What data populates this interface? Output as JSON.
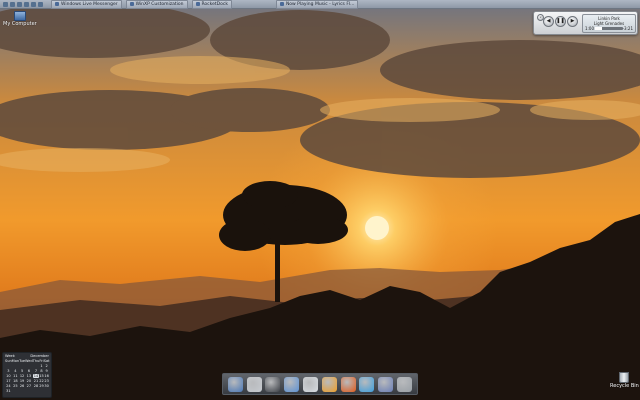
{
  "taskbar": {
    "tasks": [
      {
        "label": "Windows Live Messenger",
        "icon": "messenger-icon"
      },
      {
        "label": "WinXP Customization",
        "icon": "folder-icon"
      },
      {
        "label": "RocketDock",
        "icon": "dock-icon"
      },
      {
        "label": "Now Playing Music - Lyrics Fl...",
        "icon": "media-player-icon"
      }
    ]
  },
  "desktop_icons": {
    "my_computer": "My Computer",
    "recycle_bin": "Recycle Bin"
  },
  "player": {
    "artist": "Linkin Park",
    "track": "Light Grenades",
    "elapsed": "1:00",
    "remaining": "-3:21",
    "progress": 0.25
  },
  "calendar": {
    "week_label": "Week",
    "month": "December",
    "weekdays": [
      "Sun",
      "Mon",
      "Tue",
      "Wed",
      "Thu",
      "Fri",
      "Sat"
    ],
    "days": [
      "",
      "",
      "",
      "",
      "",
      "1",
      "2",
      "3",
      "4",
      "5",
      "6",
      "7",
      "8",
      "9",
      "10",
      "11",
      "12",
      "13",
      "14",
      "15",
      "16",
      "17",
      "18",
      "19",
      "20",
      "21",
      "22",
      "23",
      "24",
      "25",
      "26",
      "27",
      "28",
      "29",
      "30",
      "31",
      ""
    ],
    "today": "14"
  },
  "dock": {
    "items": [
      {
        "name": "my-computer-dock-icon",
        "color": "#4a78b8"
      },
      {
        "name": "apple-dock-icon",
        "color": "#c8ccd2"
      },
      {
        "name": "paw-dock-icon",
        "color": "#3b3f46"
      },
      {
        "name": "wing-dock-icon",
        "color": "#5e93d6"
      },
      {
        "name": "chrome-ball-dock-icon",
        "color": "#d9dde2"
      },
      {
        "name": "safari-dock-icon",
        "color": "#f0a02a"
      },
      {
        "name": "firefox-dock-icon",
        "color": "#e25d1e"
      },
      {
        "name": "vlc-dock-icon",
        "color": "#3da0e0"
      },
      {
        "name": "tools-dock-icon",
        "color": "#6a7fb8"
      },
      {
        "name": "trash-dock-icon",
        "color": "#9aa1a8"
      }
    ]
  },
  "colors": {
    "sky_top": "#6b7382",
    "sky_glow": "#f3a33a",
    "sun": "#fff1b8",
    "silhouette": "#1a120c"
  }
}
